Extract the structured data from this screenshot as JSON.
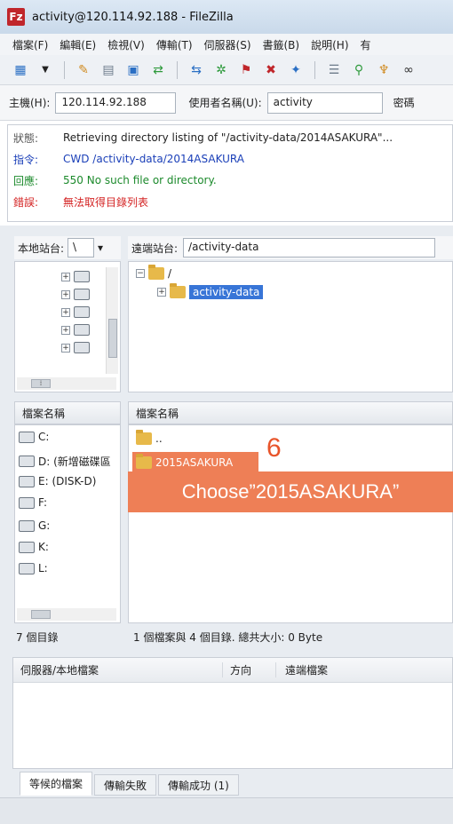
{
  "window": {
    "title": "activity@120.114.92.188 - FileZilla",
    "logo": "Fz"
  },
  "menu": [
    "檔案(F)",
    "編輯(E)",
    "檢視(V)",
    "傳輸(T)",
    "伺服器(S)",
    "書籤(B)",
    "說明(H)",
    "有"
  ],
  "quickconnect": {
    "host_label": "主機(H):",
    "host_value": "120.114.92.188",
    "user_label": "使用者名稱(U):",
    "user_value": "activity",
    "pass_label": "密碼"
  },
  "log": [
    {
      "label": "狀態:",
      "text": "Retrieving directory listing of \"/activity-data/2014ASAKURA\"..."
    },
    {
      "label": "指令:",
      "text": "CWD /activity-data/2014ASAKURA"
    },
    {
      "label": "回應:",
      "text": "550 No such file or directory."
    },
    {
      "label": "錯誤:",
      "text": "無法取得目錄列表"
    }
  ],
  "local_site": {
    "label": "本地站台:",
    "value": "\\",
    "dropdown": "▾"
  },
  "remote_site": {
    "label": "遠端站台:",
    "value": "/activity-data"
  },
  "remote_tree": {
    "root": "/",
    "child": "activity-data"
  },
  "local_list": {
    "header": "檔案名稱",
    "items": [
      "C:",
      "D: (新增磁碟區",
      "E: (DISK-D)",
      "F:",
      "G:",
      "K:",
      "L:"
    ],
    "status": "7 個目錄"
  },
  "remote_list": {
    "header": "檔案名稱",
    "items": [
      "..",
      "2015ASAKURA"
    ],
    "status": "1 個檔案與 4 個目錄. 總共大小: 0 Byte"
  },
  "annotation": {
    "step": "6",
    "text": "Choose”2015ASAKURA”"
  },
  "queue": {
    "col_server": "伺服器/本地檔案",
    "col_direction": "方向",
    "col_remote": "遠端檔案"
  },
  "tabs": [
    "等候的檔案",
    "傳輸失敗",
    "傳輸成功 (1)"
  ],
  "colors": {
    "annotation": "#ee7f56",
    "selection": "#3875d7",
    "error": "#d42424",
    "success": "#1c8a2c",
    "command": "#1a3fb8"
  }
}
